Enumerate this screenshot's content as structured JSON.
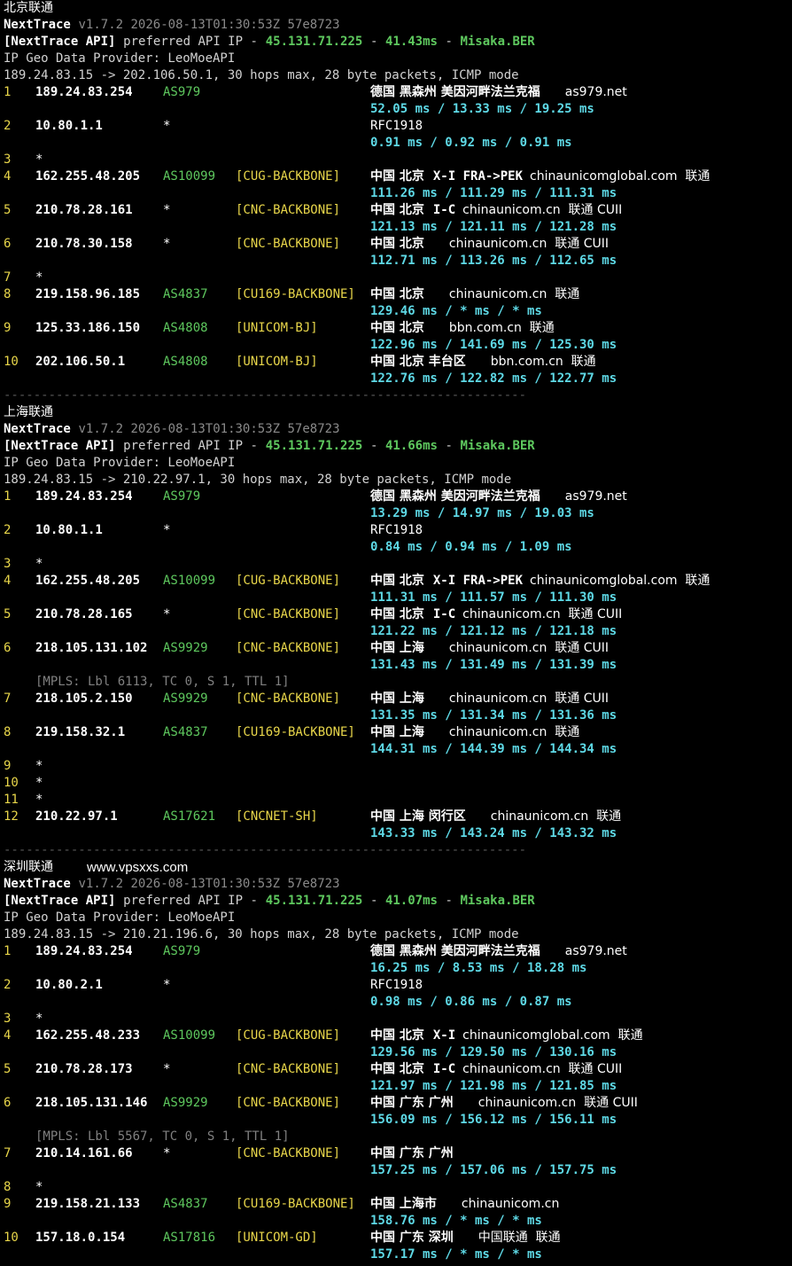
{
  "sections": [
    {
      "title": "北京联通",
      "header": {
        "tool": "NextTrace",
        "version": "v1.7.2 2026-08-13T01:30:53Z 57e8723",
        "api_tag": "[NextTrace API]",
        "api_text": " preferred API IP - ",
        "api_ip": "45.131.71.225",
        "dash1": " - ",
        "latency": "41.43ms",
        "dash2": " - ",
        "node": "Misaka.BER",
        "geo": "IP Geo Data Provider: LeoMoeAPI",
        "route": "189.24.83.15 -> 202.106.50.1, 30 hops max, 28 byte packets, ICMP mode"
      },
      "hops": [
        {
          "n": "1",
          "ip": "189.24.83.254",
          "asn": "AS979",
          "tag": "",
          "geo": "德国 黑森州 美因河畔法兰克福",
          "extra": "as979.net",
          "times": "52.05 ms / 13.33 ms / 19.25 ms"
        },
        {
          "n": "2",
          "ip": "10.80.1.1",
          "asn": "*",
          "tag": "",
          "geo": "RFC1918",
          "extra": "",
          "times": "0.91 ms / 0.92 ms / 0.91 ms"
        },
        {
          "n": "3",
          "ip": "*"
        },
        {
          "n": "4",
          "ip": "162.255.48.205",
          "asn": "AS10099",
          "tag": "[CUG-BACKBONE]",
          "geo": "中国 北京",
          "isp": "X-I FRA->PEK",
          "extra": "chinaunicomglobal.com  联通",
          "times": "111.26 ms / 111.29 ms / 111.31 ms"
        },
        {
          "n": "5",
          "ip": "210.78.28.161",
          "asn": "*",
          "tag": "[CNC-BACKBONE]",
          "geo": "中国 北京",
          "isp": "I-C",
          "extra": "chinaunicom.cn  联通 CUII",
          "times": "121.13 ms / 121.11 ms / 121.28 ms"
        },
        {
          "n": "6",
          "ip": "210.78.30.158",
          "asn": "*",
          "tag": "[CNC-BACKBONE]",
          "geo": "中国 北京",
          "extra": "chinaunicom.cn  联通 CUII",
          "times": "112.71 ms / 113.26 ms / 112.65 ms"
        },
        {
          "n": "7",
          "ip": "*"
        },
        {
          "n": "8",
          "ip": "219.158.96.185",
          "asn": "AS4837",
          "tag": "[CU169-BACKBONE]",
          "geo": "中国 北京",
          "extra": "chinaunicom.cn  联通",
          "times": "129.46 ms / * ms / * ms"
        },
        {
          "n": "9",
          "ip": "125.33.186.150",
          "asn": "AS4808",
          "tag": "[UNICOM-BJ]",
          "geo": "中国 北京",
          "extra": "bbn.com.cn  联通",
          "times": "122.96 ms / 141.69 ms / 125.30 ms"
        },
        {
          "n": "10",
          "ip": "202.106.50.1",
          "asn": "AS4808",
          "tag": "[UNICOM-BJ]",
          "geo": "中国 北京 丰台区",
          "extra": "bbn.com.cn  联通",
          "times": "122.76 ms / 122.82 ms / 122.77 ms"
        }
      ]
    },
    {
      "title": "上海联通",
      "header": {
        "tool": "NextTrace",
        "version": "v1.7.2 2026-08-13T01:30:53Z 57e8723",
        "api_tag": "[NextTrace API]",
        "api_text": " preferred API IP - ",
        "api_ip": "45.131.71.225",
        "dash1": " - ",
        "latency": "41.66ms",
        "dash2": " - ",
        "node": "Misaka.BER",
        "geo": "IP Geo Data Provider: LeoMoeAPI",
        "route": "189.24.83.15 -> 210.22.97.1, 30 hops max, 28 byte packets, ICMP mode"
      },
      "hops": [
        {
          "n": "1",
          "ip": "189.24.83.254",
          "asn": "AS979",
          "tag": "",
          "geo": "德国 黑森州 美因河畔法兰克福",
          "extra": "as979.net",
          "times": "13.29 ms / 14.97 ms / 19.03 ms"
        },
        {
          "n": "2",
          "ip": "10.80.1.1",
          "asn": "*",
          "tag": "",
          "geo": "RFC1918",
          "extra": "",
          "times": "0.84 ms / 0.94 ms / 1.09 ms"
        },
        {
          "n": "3",
          "ip": "*"
        },
        {
          "n": "4",
          "ip": "162.255.48.205",
          "asn": "AS10099",
          "tag": "[CUG-BACKBONE]",
          "geo": "中国 北京",
          "isp": "X-I FRA->PEK",
          "extra": "chinaunicomglobal.com  联通",
          "times": "111.31 ms / 111.57 ms / 111.30 ms"
        },
        {
          "n": "5",
          "ip": "210.78.28.165",
          "asn": "*",
          "tag": "[CNC-BACKBONE]",
          "geo": "中国 北京",
          "isp": "I-C",
          "extra": "chinaunicom.cn  联通 CUII",
          "times": "121.22 ms / 121.12 ms / 121.18 ms"
        },
        {
          "n": "6",
          "ip": "218.105.131.102",
          "asn": "AS9929",
          "tag": "[CNC-BACKBONE]",
          "geo": "中国 上海",
          "extra": "chinaunicom.cn  联通 CUII",
          "times": "131.43 ms / 131.49 ms / 131.39 ms",
          "mpls": "[MPLS: Lbl 6113, TC 0, S 1, TTL 1]"
        },
        {
          "n": "7",
          "ip": "218.105.2.150",
          "asn": "AS9929",
          "tag": "[CNC-BACKBONE]",
          "geo": "中国 上海",
          "extra": "chinaunicom.cn  联通 CUII",
          "times": "131.35 ms / 131.34 ms / 131.36 ms"
        },
        {
          "n": "8",
          "ip": "219.158.32.1",
          "asn": "AS4837",
          "tag": "[CU169-BACKBONE]",
          "geo": "中国 上海",
          "extra": "chinaunicom.cn  联通",
          "times": "144.31 ms / 144.39 ms / 144.34 ms"
        },
        {
          "n": "9",
          "ip": "*"
        },
        {
          "n": "10",
          "ip": "*"
        },
        {
          "n": "11",
          "ip": "*"
        },
        {
          "n": "12",
          "ip": "210.22.97.1",
          "asn": "AS17621",
          "tag": "[CNCNET-SH]",
          "geo": "中国 上海 闵行区",
          "extra": "chinaunicom.cn  联通",
          "times": "143.33 ms / 143.24 ms / 143.32 ms"
        }
      ]
    },
    {
      "title": "深圳联通",
      "watermark": "www.vpsxxs.com",
      "header": {
        "tool": "NextTrace",
        "version": "v1.7.2 2026-08-13T01:30:53Z 57e8723",
        "api_tag": "[NextTrace API]",
        "api_text": " preferred API IP - ",
        "api_ip": "45.131.71.225",
        "dash1": " - ",
        "latency": "41.07ms",
        "dash2": " - ",
        "node": "Misaka.BER",
        "geo": "IP Geo Data Provider: LeoMoeAPI",
        "route": "189.24.83.15 -> 210.21.196.6, 30 hops max, 28 byte packets, ICMP mode"
      },
      "hops": [
        {
          "n": "1",
          "ip": "189.24.83.254",
          "asn": "AS979",
          "tag": "",
          "geo": "德国 黑森州 美因河畔法兰克福",
          "extra": "as979.net",
          "times": "16.25 ms / 8.53 ms / 18.28 ms"
        },
        {
          "n": "2",
          "ip": "10.80.2.1",
          "asn": "*",
          "tag": "",
          "geo": "RFC1918",
          "extra": "",
          "times": "0.98 ms / 0.86 ms / 0.87 ms"
        },
        {
          "n": "3",
          "ip": "*"
        },
        {
          "n": "4",
          "ip": "162.255.48.233",
          "asn": "AS10099",
          "tag": "[CUG-BACKBONE]",
          "geo": "中国 北京",
          "isp": "X-I",
          "extra": "chinaunicomglobal.com  联通",
          "times": "129.56 ms / 129.50 ms / 130.16 ms"
        },
        {
          "n": "5",
          "ip": "210.78.28.173",
          "asn": "*",
          "tag": "[CNC-BACKBONE]",
          "geo": "中国 北京",
          "isp": "I-C",
          "extra": "chinaunicom.cn  联通 CUII",
          "times": "121.97 ms / 121.98 ms / 121.85 ms"
        },
        {
          "n": "6",
          "ip": "218.105.131.146",
          "asn": "AS9929",
          "tag": "[CNC-BACKBONE]",
          "geo": "中国 广东 广州",
          "extra": "chinaunicom.cn  联通 CUII",
          "times": "156.09 ms / 156.12 ms / 156.11 ms",
          "mpls": "[MPLS: Lbl 5567, TC 0, S 1, TTL 1]"
        },
        {
          "n": "7",
          "ip": "210.14.161.66",
          "asn": "*",
          "tag": "[CNC-BACKBONE]",
          "geo": "中国 广东 广州",
          "extra": "",
          "times": "157.25 ms / 157.06 ms / 157.75 ms"
        },
        {
          "n": "8",
          "ip": "*"
        },
        {
          "n": "9",
          "ip": "219.158.21.133",
          "asn": "AS4837",
          "tag": "[CU169-BACKBONE]",
          "geo": "中国 上海市",
          "extra": "chinaunicom.cn",
          "times": "158.76 ms / * ms / * ms"
        },
        {
          "n": "10",
          "ip": "157.18.0.154",
          "asn": "AS17816",
          "tag": "[UNICOM-GD]",
          "geo": "中国 广东 深圳",
          "extra": "中国联通  联通",
          "times": "157.17 ms / * ms / * ms"
        }
      ]
    }
  ],
  "separator": "----------------------------------------------------------------------",
  "colors": {
    "background": "#000000",
    "ip_asn": "#5ec85e",
    "tag": "#e8d64a",
    "latency": "#5ed9e6",
    "hop_no": "#e8d64a"
  }
}
